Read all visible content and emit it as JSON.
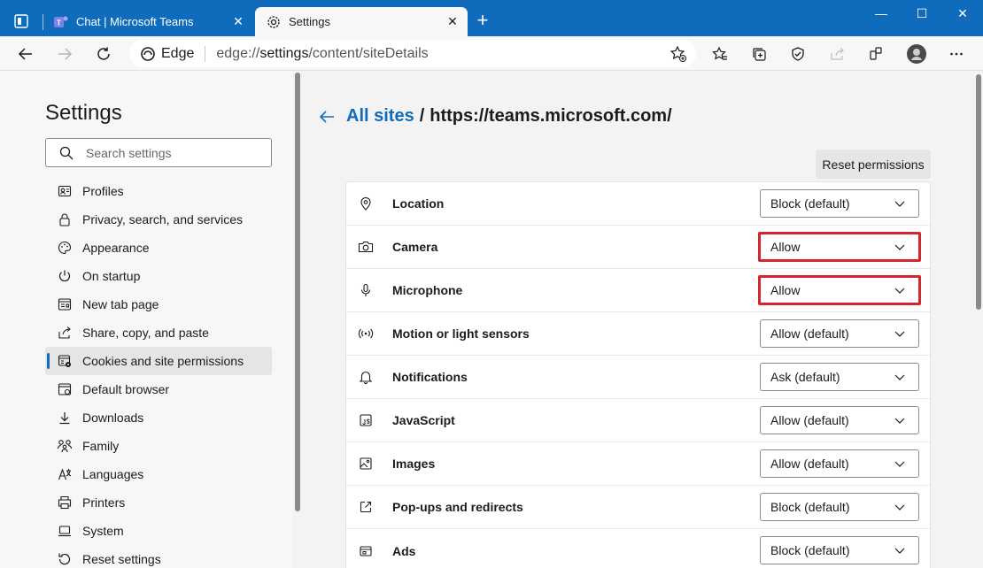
{
  "tabs": [
    {
      "title": "Chat | Microsoft Teams",
      "icon": "teams-icon"
    },
    {
      "title": "Settings",
      "icon": "gear-icon",
      "active": true
    }
  ],
  "address": {
    "brand": "Edge",
    "url_prefix": "edge://",
    "url_bold": "settings",
    "url_rest": "/content/siteDetails"
  },
  "sidebar": {
    "title": "Settings",
    "search_placeholder": "Search settings",
    "items": [
      {
        "label": "Profiles",
        "icon": "profile-icon"
      },
      {
        "label": "Privacy, search, and services",
        "icon": "lock-icon"
      },
      {
        "label": "Appearance",
        "icon": "palette-icon"
      },
      {
        "label": "On startup",
        "icon": "power-icon"
      },
      {
        "label": "New tab page",
        "icon": "new-tab-page-icon"
      },
      {
        "label": "Share, copy, and paste",
        "icon": "share-icon"
      },
      {
        "label": "Cookies and site permissions",
        "icon": "cookies-icon",
        "selected": true
      },
      {
        "label": "Default browser",
        "icon": "browser-icon"
      },
      {
        "label": "Downloads",
        "icon": "download-icon"
      },
      {
        "label": "Family",
        "icon": "family-icon"
      },
      {
        "label": "Languages",
        "icon": "languages-icon"
      },
      {
        "label": "Printers",
        "icon": "printer-icon"
      },
      {
        "label": "System",
        "icon": "laptop-icon"
      },
      {
        "label": "Reset settings",
        "icon": "reset-icon"
      }
    ]
  },
  "main": {
    "breadcrumb_link": "All sites",
    "breadcrumb_sep": "/",
    "site": "https://teams.microsoft.com/",
    "reset_button": "Reset permissions",
    "permissions": [
      {
        "label": "Location",
        "value": "Block (default)",
        "icon": "location-icon"
      },
      {
        "label": "Camera",
        "value": "Allow",
        "icon": "camera-icon",
        "highlight": true
      },
      {
        "label": "Microphone",
        "value": "Allow",
        "icon": "microphone-icon",
        "highlight": true
      },
      {
        "label": "Motion or light sensors",
        "value": "Allow (default)",
        "icon": "sensors-icon"
      },
      {
        "label": "Notifications",
        "value": "Ask (default)",
        "icon": "bell-icon"
      },
      {
        "label": "JavaScript",
        "value": "Allow (default)",
        "icon": "javascript-icon"
      },
      {
        "label": "Images",
        "value": "Allow (default)",
        "icon": "image-icon"
      },
      {
        "label": "Pop-ups and redirects",
        "value": "Block (default)",
        "icon": "popup-icon"
      },
      {
        "label": "Ads",
        "value": "Block (default)",
        "icon": "ads-icon"
      }
    ]
  },
  "colors": {
    "accent": "#0f6cbd",
    "highlight": "#d42532"
  }
}
